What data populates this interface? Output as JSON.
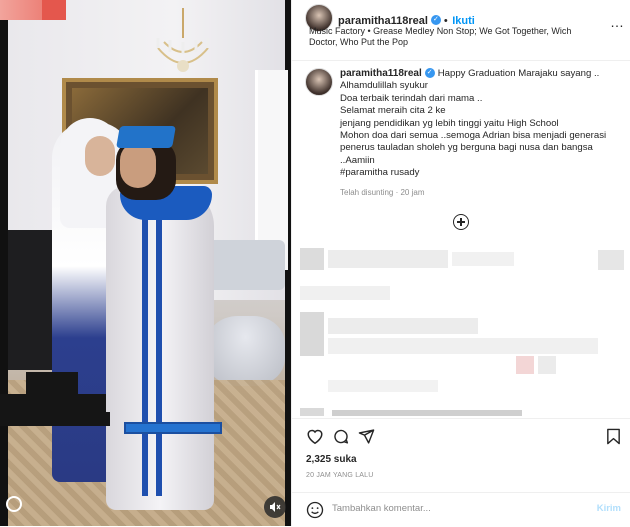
{
  "post": {
    "username": "paramitha118real",
    "follow_label": "Ikuti",
    "music": "Music Factory • Grease Medley Non Stop; We Got Together, Wich Doctor, Who Put the Pop",
    "more_label": "…"
  },
  "caption": {
    "username": "paramitha118real",
    "lines": [
      "Happy Graduation Marajaku sayang ..",
      "Alhamdulillah syukur",
      "Doa terbaik terindah dari mama ..",
      "Selamat meraih cita 2 ke",
      "jenjang pendidikan yg lebih tinggi yaitu High School",
      "Mohon doa dari semua ..semoga Adrian bisa menjadi generasi",
      "penerus tauladan sholeh yg berguna bagi nusa dan bangsa",
      "..Aamiin",
      "#paramitha rusady"
    ],
    "edited": "Telah disunting · 20 jam"
  },
  "engagement": {
    "likes": "2,325 suka",
    "posted_ago": "20 JAM YANG LALU"
  },
  "comment": {
    "placeholder": "Tambahkan komentar...",
    "send_label": "Kirim"
  },
  "icons": {
    "like": "heart-icon",
    "comment": "comment-icon",
    "share": "share-icon",
    "save": "bookmark-icon",
    "emoji": "emoji-icon",
    "load_more": "plus-circle-icon",
    "mute": "speaker-muted-icon",
    "verified": "verified-badge-icon"
  },
  "colors": {
    "link": "#0095f6",
    "verified": "#3797f0",
    "muted_text": "#8e8e8e",
    "send_disabled": "#b2dffc"
  }
}
